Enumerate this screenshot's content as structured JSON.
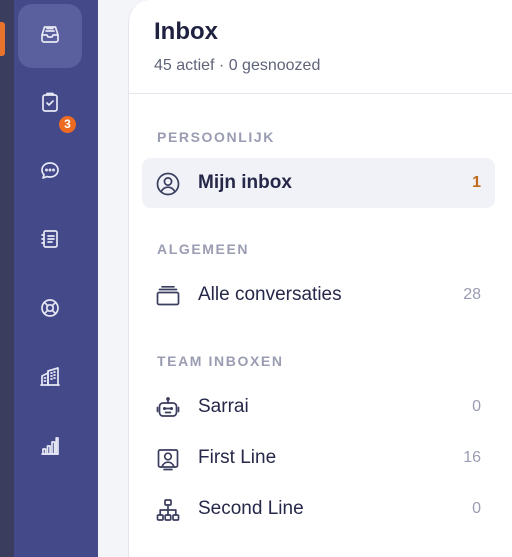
{
  "rail": {
    "items": [
      {
        "icon": "inbox-tray-icon",
        "active": true
      },
      {
        "icon": "clipboard-check-icon",
        "badge": "3"
      },
      {
        "icon": "chat-bubble-icon"
      },
      {
        "icon": "notebook-icon"
      },
      {
        "icon": "lifebuoy-icon"
      },
      {
        "icon": "buildings-icon"
      },
      {
        "icon": "bar-chart-icon"
      }
    ],
    "accent_color": "#e8732c"
  },
  "header": {
    "title": "Inbox",
    "subtitle": "45 actief · 0 gesnoozed"
  },
  "sections": {
    "personal": {
      "label": "PERSOONLIJK",
      "items": [
        {
          "label": "Mijn inbox",
          "count": "1",
          "icon": "user-circle-icon",
          "active": true
        }
      ]
    },
    "general": {
      "label": "ALGEMEEN",
      "items": [
        {
          "label": "Alle conversaties",
          "count": "28",
          "icon": "stacked-trays-icon"
        }
      ]
    },
    "team": {
      "label": "TEAM INBOXEN",
      "items": [
        {
          "label": "Sarrai",
          "count": "0",
          "icon": "robot-icon"
        },
        {
          "label": "First Line",
          "count": "16",
          "icon": "user-square-icon"
        },
        {
          "label": "Second Line",
          "count": "0",
          "icon": "hierarchy-icon"
        }
      ]
    }
  },
  "colors": {
    "rail_bg": "#434989",
    "active_count": "#c26a1c",
    "badge": "#ec6a22"
  }
}
